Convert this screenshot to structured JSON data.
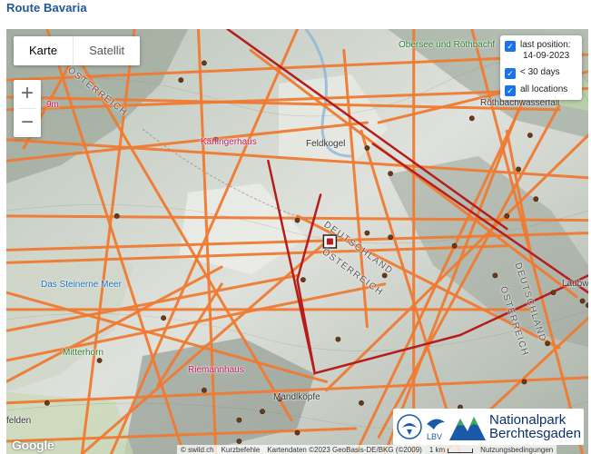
{
  "title": "Route Bavaria",
  "map_type": {
    "options": [
      "Karte",
      "Satellit"
    ],
    "selected": "Karte"
  },
  "zoom": {
    "in": "+",
    "out": "−"
  },
  "legend": [
    {
      "label": "last position: 14-09-2023",
      "line1": "last position:",
      "line2": "14-09-2023",
      "checked": true
    },
    {
      "label": "< 30 days",
      "checked": true
    },
    {
      "label": "all locations",
      "checked": true
    }
  ],
  "places": {
    "obersee": "Obersee und Röthbachf",
    "roethbach": "Röthbachwasserfall",
    "kaerlinger": "Kärlingerhaus",
    "feldkogel": "Feldkogel",
    "steinerne": "Das Steinerne Meer",
    "mitterhorn": "Mitterhorn",
    "riemann": "Riemannhaus",
    "mandl": "Mandlköpfe",
    "laubwa": "Laubwa",
    "felden": "felden",
    "partial_9m": "9m"
  },
  "borders": {
    "oesterreich_1": "ÖSTERREICH",
    "deutschland_1": "DEUTSCHLAND",
    "oesterreich_2": "ÖSTERREICH",
    "deutschland_2": "DEUTSCHLAND",
    "oesterreich_3": "ÖSTERREICH"
  },
  "logo": {
    "badge_text": "LBV",
    "line1": "Nationalpark",
    "line2": "Berchtesgaden"
  },
  "google": "Google",
  "attribution": {
    "swild": "© swild.ch",
    "shortcuts": "Kurzbefehle",
    "mapdata": "Kartendaten ©2023 GeoBasis-DE/BKG (©2009)",
    "scale": "1 km",
    "terms": "Nutzungsbedingungen"
  },
  "colors": {
    "track_old": "#ef7a32",
    "track_recent": "#b71c1c",
    "point": "#6b3a1a",
    "title": "#1e5799"
  },
  "tracks": {
    "old_segments": [
      [
        [
          0.13,
          0.03
        ],
        [
          0.03,
          0.28
        ]
      ],
      [
        [
          0.0,
          0.12
        ],
        [
          1.0,
          0.06
        ]
      ],
      [
        [
          0.0,
          0.16
        ],
        [
          0.95,
          0.19
        ]
      ],
      [
        [
          0.0,
          0.19
        ],
        [
          1.0,
          0.14
        ]
      ],
      [
        [
          0.0,
          0.26
        ],
        [
          1.0,
          0.35
        ]
      ],
      [
        [
          0.0,
          0.31
        ],
        [
          0.62,
          0.22
        ]
      ],
      [
        [
          0.0,
          0.44
        ],
        [
          1.0,
          0.45
        ]
      ],
      [
        [
          0.0,
          0.52
        ],
        [
          1.0,
          0.48
        ]
      ],
      [
        [
          0.0,
          0.55
        ],
        [
          0.86,
          0.51
        ]
      ],
      [
        [
          0.0,
          0.62
        ],
        [
          0.55,
          0.83
        ]
      ],
      [
        [
          0.0,
          0.66
        ],
        [
          0.9,
          0.66
        ]
      ],
      [
        [
          0.0,
          0.71
        ],
        [
          0.5,
          0.58
        ]
      ],
      [
        [
          0.0,
          0.78
        ],
        [
          0.65,
          0.6
        ]
      ],
      [
        [
          0.0,
          0.88
        ],
        [
          1.0,
          0.82
        ]
      ],
      [
        [
          0.0,
          0.97
        ],
        [
          0.6,
          0.94
        ]
      ],
      [
        [
          0.07,
          0.0
        ],
        [
          0.3,
          0.98
        ]
      ],
      [
        [
          0.12,
          0.06
        ],
        [
          0.49,
          0.92
        ]
      ],
      [
        [
          0.22,
          0.0
        ],
        [
          0.13,
          1.0
        ]
      ],
      [
        [
          0.33,
          0.0
        ],
        [
          0.36,
          1.0
        ]
      ],
      [
        [
          0.5,
          0.0
        ],
        [
          0.18,
          1.0
        ]
      ],
      [
        [
          0.58,
          0.05
        ],
        [
          0.62,
          0.7
        ]
      ],
      [
        [
          0.61,
          0.24
        ],
        [
          0.78,
          1.0
        ]
      ],
      [
        [
          0.64,
          0.22
        ],
        [
          1.0,
          0.1
        ]
      ],
      [
        [
          0.7,
          0.0
        ],
        [
          0.7,
          1.0
        ]
      ],
      [
        [
          0.8,
          0.0
        ],
        [
          0.99,
          1.0
        ]
      ],
      [
        [
          0.86,
          0.24
        ],
        [
          0.9,
          0.52
        ]
      ],
      [
        [
          0.88,
          0.19
        ],
        [
          0.65,
          1.0
        ]
      ],
      [
        [
          0.93,
          0.05
        ],
        [
          0.6,
          1.0
        ]
      ],
      [
        [
          0.95,
          0.18
        ],
        [
          0.64,
          0.96
        ]
      ],
      [
        [
          1.0,
          0.25
        ],
        [
          0.55,
          0.85
        ]
      ],
      [
        [
          0.37,
          0.56
        ],
        [
          0.0,
          0.83
        ]
      ],
      [
        [
          0.5,
          0.44
        ],
        [
          0.95,
          0.75
        ]
      ],
      [
        [
          0.26,
          0.84
        ],
        [
          0.37,
          0.6
        ]
      ],
      [
        [
          0.42,
          0.05
        ],
        [
          0.98,
          0.63
        ]
      ],
      [
        [
          0.55,
          0.5
        ],
        [
          0.13,
          1.0
        ]
      ],
      [
        [
          1.0,
          0.68
        ],
        [
          0.75,
          1.0
        ]
      ]
    ],
    "recent_segments": [
      [
        [
          0.38,
          0.0
        ],
        [
          0.86,
          0.47
        ]
      ],
      [
        [
          0.63,
          0.27
        ],
        [
          1.0,
          0.62
        ]
      ],
      [
        [
          0.54,
          0.39
        ],
        [
          0.5,
          0.59
        ],
        [
          0.53,
          0.81
        ],
        [
          0.78,
          0.72
        ],
        [
          1.0,
          0.58
        ]
      ],
      [
        [
          0.45,
          0.31
        ],
        [
          0.53,
          0.81
        ]
      ]
    ],
    "points": [
      [
        0.3,
        0.12
      ],
      [
        0.34,
        0.08
      ],
      [
        0.19,
        0.44
      ],
      [
        0.27,
        0.68
      ],
      [
        0.36,
        0.26
      ],
      [
        0.5,
        0.45
      ],
      [
        0.51,
        0.59
      ],
      [
        0.62,
        0.28
      ],
      [
        0.66,
        0.34
      ],
      [
        0.62,
        0.48
      ],
      [
        0.65,
        0.58
      ],
      [
        0.66,
        0.49
      ],
      [
        0.61,
        0.88
      ],
      [
        0.44,
        0.9
      ],
      [
        0.34,
        0.85
      ],
      [
        0.4,
        0.92
      ],
      [
        0.57,
        0.73
      ],
      [
        0.47,
        0.87
      ],
      [
        0.78,
        0.89
      ],
      [
        0.77,
        0.51
      ],
      [
        0.86,
        0.44
      ],
      [
        0.88,
        0.33
      ],
      [
        0.9,
        0.25
      ],
      [
        0.84,
        0.58
      ],
      [
        0.94,
        0.62
      ],
      [
        1.0,
        0.65
      ],
      [
        0.93,
        0.74
      ],
      [
        0.89,
        0.83
      ],
      [
        0.8,
        0.21
      ],
      [
        0.99,
        0.64
      ],
      [
        0.07,
        0.88
      ],
      [
        0.5,
        0.95
      ],
      [
        0.16,
        0.78
      ],
      [
        0.91,
        0.4
      ],
      [
        0.4,
        0.97
      ]
    ],
    "last_position": [
      0.556,
      0.5
    ]
  }
}
